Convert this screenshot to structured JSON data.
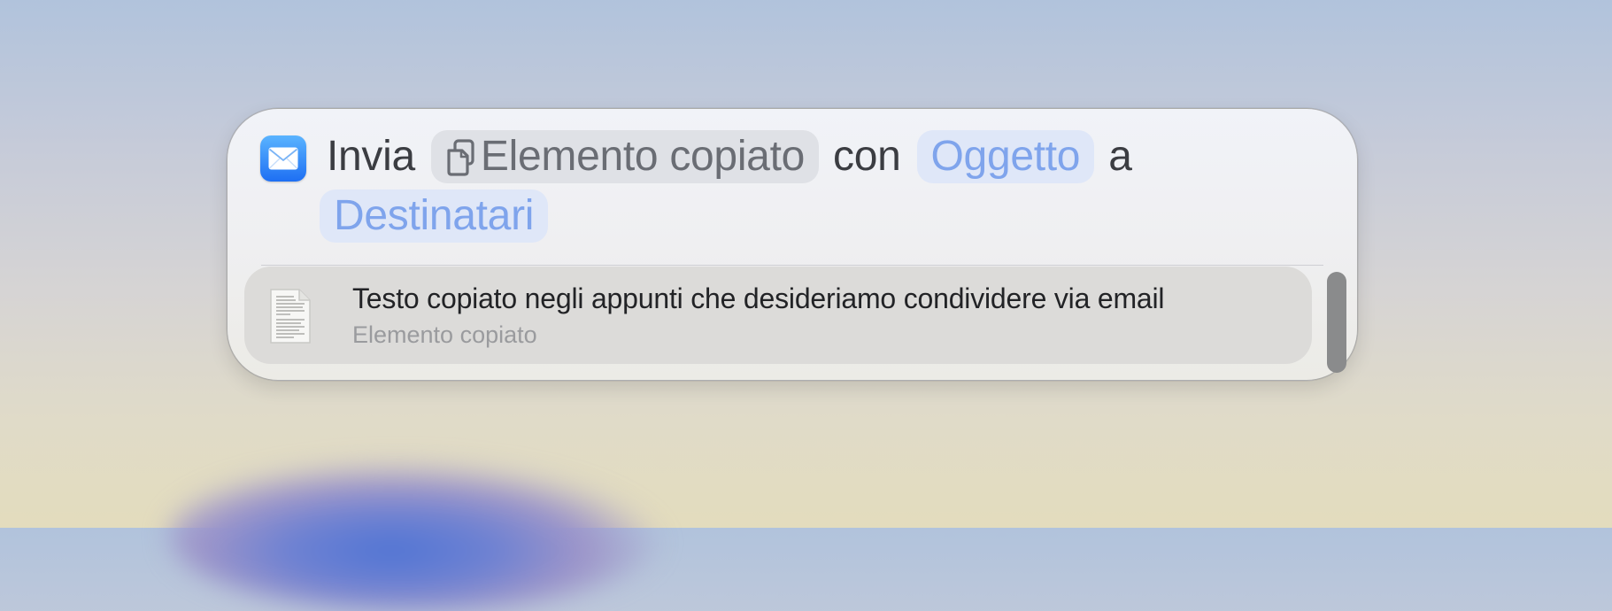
{
  "action": {
    "app_icon": "mail-icon",
    "verb": "Invia",
    "variable_token": {
      "icon": "clipboard-copy-icon",
      "label": "Elemento copiato"
    },
    "connector_with": "con",
    "subject_param": "Oggetto",
    "connector_to": "a",
    "recipients_param": "Destinatari"
  },
  "result_item": {
    "icon": "document-icon",
    "title": "Testo copiato negli appunti che desideriamo condividere via email",
    "subtitle": "Elemento copiato"
  },
  "colors": {
    "param_text": "#7fa4ec",
    "param_bg": "#dfe7f8",
    "variable_bg": "#dfe1e6",
    "mail_icon_top": "#5ab4ff",
    "mail_icon_bottom": "#1e6ff3"
  }
}
